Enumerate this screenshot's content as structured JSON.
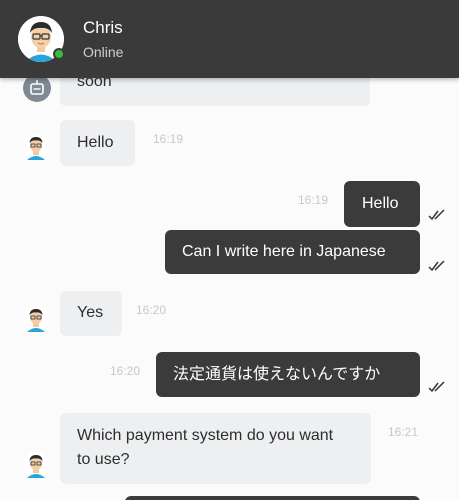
{
  "contact": {
    "name": "Chris",
    "status": "Online"
  },
  "messages": [
    {
      "from": "bot",
      "text": "soon"
    },
    {
      "from": "contact",
      "text": "Hello",
      "time": "16:19"
    },
    {
      "from": "me",
      "text": "Hello",
      "time": "16:19",
      "read": true
    },
    {
      "from": "me",
      "text": "Can I write here in Japanese",
      "read": true
    },
    {
      "from": "contact",
      "text": "Yes",
      "time": "16:20"
    },
    {
      "from": "me",
      "text": "法定通貨は使えないんですか",
      "time": "16:20",
      "read": true
    },
    {
      "from": "contact",
      "text": "Which payment system do you want to use?",
      "time": "16:21"
    }
  ],
  "colors": {
    "header": "#3a3a3a",
    "online": "#3cb83c",
    "incoming": "#edeff1",
    "outgoing": "#3b3b3b"
  },
  "icons": {
    "read": "double-check-icon",
    "bot": "robot-icon"
  }
}
